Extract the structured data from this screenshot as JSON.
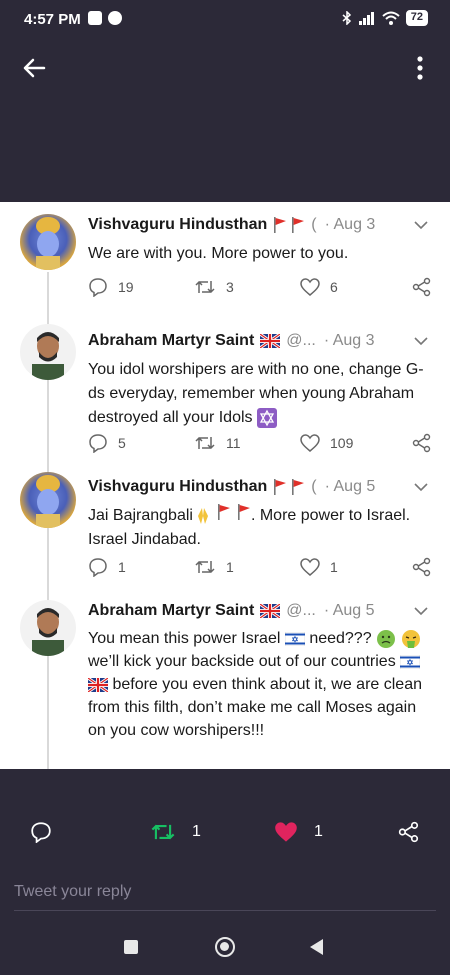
{
  "status_bar": {
    "time": "4:57 PM",
    "battery": "72"
  },
  "header": {
    "back_label": "Back",
    "more_label": "More options"
  },
  "tweets": [
    {
      "name": "Vishvaguru Hindusthan",
      "handle": "(",
      "date": "· Aug 3",
      "body": "We are with you. More power to you.",
      "replies": "19",
      "retweets": "3",
      "likes": "6"
    },
    {
      "name": "Abraham Martyr Saint",
      "handle": "@...",
      "date": "· Aug 3",
      "body": "You idol worshipers are with no one, change G-ds everyday, remember when young Abraham destroyed all your Idols",
      "replies": "5",
      "retweets": "11",
      "likes": "109"
    },
    {
      "name": "Vishvaguru Hindusthan",
      "handle": "(",
      "date": "· Aug 5",
      "body_a": "Jai Bajrangbali",
      "body_b": ". More power to Israel.  Israel Jindabad.",
      "replies": "1",
      "retweets": "1",
      "likes": "1"
    },
    {
      "name": "Abraham Martyr Saint",
      "handle": "@...",
      "date": "· Aug 5",
      "body_a": "You mean this power Israel",
      "body_b": "need???",
      "body_c": "we’ll kick your backside out of our countries",
      "body_d": "before you even think about it, we are clean from this filth, don’t make me call Moses again on you cow worshipers!!!"
    }
  ],
  "bottom": {
    "retweet_count": "1",
    "like_count": "1",
    "reply_placeholder": "Tweet your reply"
  },
  "colors": {
    "accent_green": "#17bf63",
    "like_red": "#e0245e",
    "chrome": "#2c2938"
  }
}
